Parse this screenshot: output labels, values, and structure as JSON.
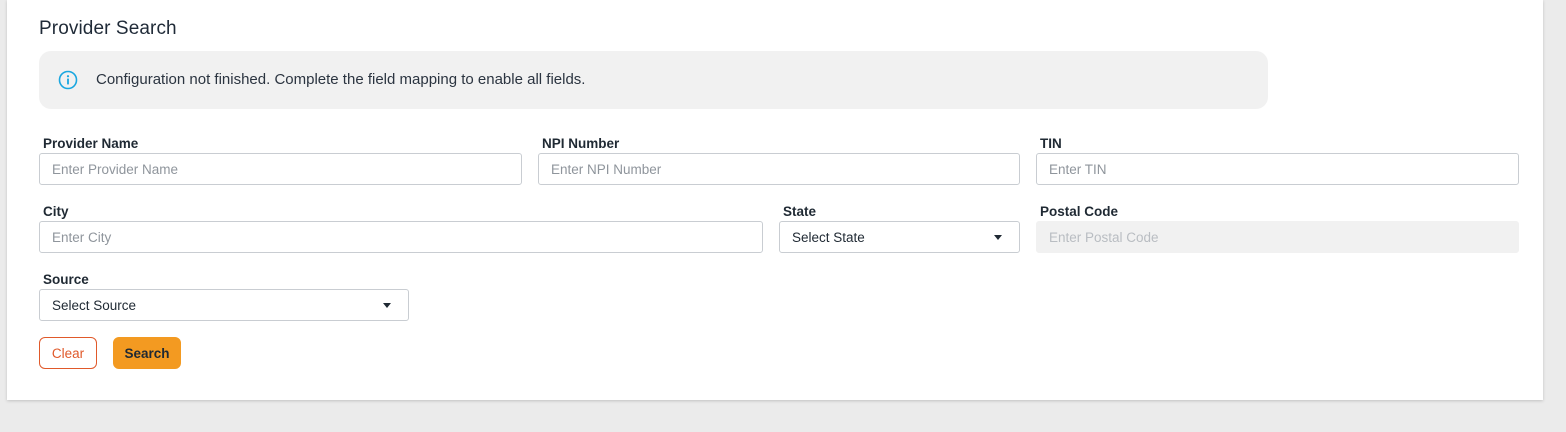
{
  "page": {
    "title": "Provider Search"
  },
  "banner": {
    "icon": "info-circle-icon",
    "icon_color": "#1aa7e0",
    "message": "Configuration not finished. Complete the field mapping to enable all fields."
  },
  "fields": {
    "provider_name": {
      "label": "Provider Name",
      "placeholder": "Enter Provider Name",
      "value": ""
    },
    "npi_number": {
      "label": "NPI Number",
      "placeholder": "Enter NPI Number",
      "value": ""
    },
    "tin": {
      "label": "TIN",
      "placeholder": "Enter TIN",
      "value": ""
    },
    "city": {
      "label": "City",
      "placeholder": "Enter City",
      "value": ""
    },
    "state": {
      "label": "State",
      "selected": "Select State"
    },
    "postal_code": {
      "label": "Postal Code",
      "placeholder": "Enter Postal Code",
      "value": "",
      "disabled": true
    },
    "source": {
      "label": "Source",
      "selected": "Select Source"
    }
  },
  "actions": {
    "clear_label": "Clear",
    "search_label": "Search"
  },
  "colors": {
    "accent": "#f39a21",
    "clear_border": "#e0592a",
    "banner_background": "#f1f1f1",
    "page_background": "#ebebeb"
  }
}
